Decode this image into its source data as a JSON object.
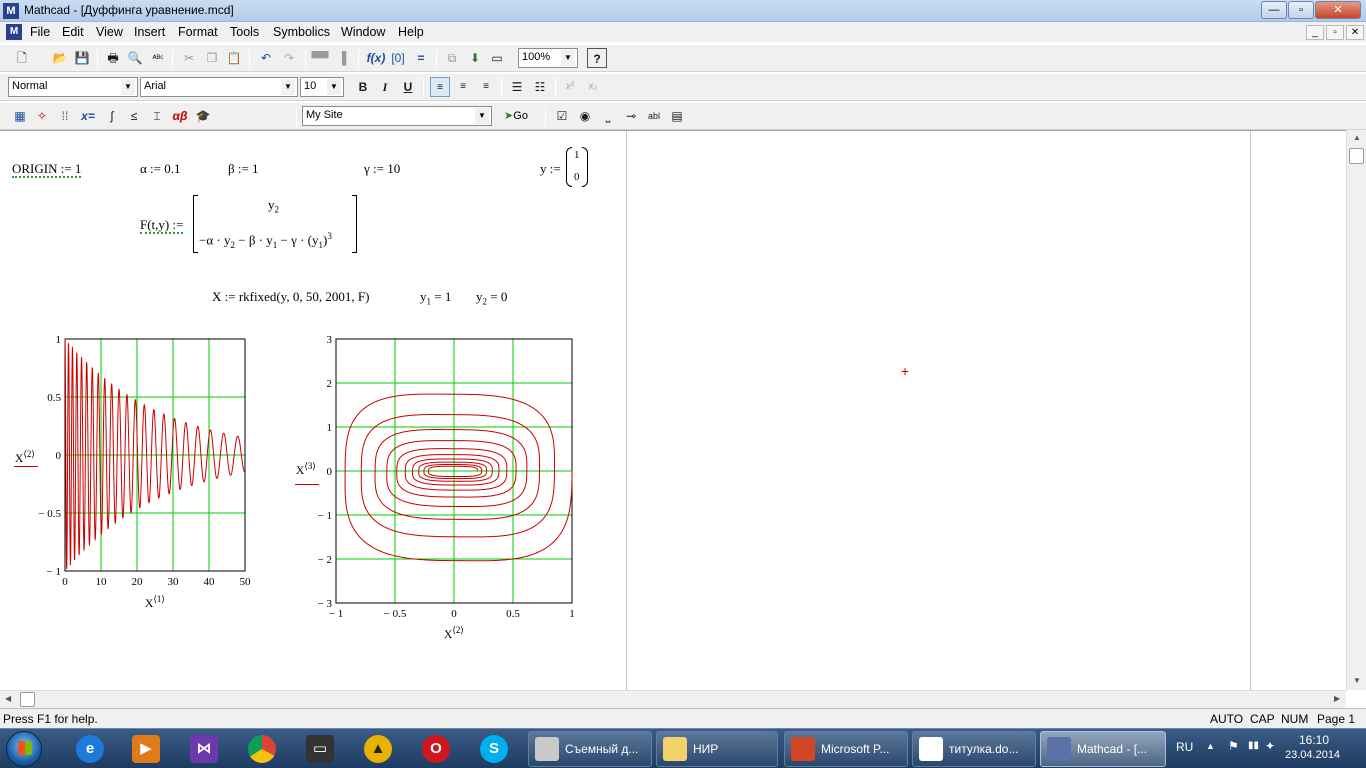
{
  "window": {
    "title": "Mathcad - [Дуффинга уравнение.mcd]",
    "logo": "M",
    "minimize": "—",
    "maximize": "▫",
    "close": "✕"
  },
  "menu": {
    "items": [
      "File",
      "Edit",
      "View",
      "Insert",
      "Format",
      "Tools",
      "Symbolics",
      "Window",
      "Help"
    ],
    "doc_controls": [
      "_",
      "▫",
      "✕"
    ]
  },
  "toolbar_standard": {
    "zoom": "100%",
    "icons": [
      "new-icon",
      "open-icon",
      "save-icon",
      "print-icon",
      "print-preview-icon",
      "spell-check-icon",
      "cut-icon",
      "copy-icon",
      "paste-icon",
      "undo-icon",
      "redo-icon",
      "align-across-icon",
      "align-down-icon",
      "insert-function-icon",
      "insert-unit-icon",
      "calculate-icon",
      "resources-icon",
      "component-icon",
      "hyperlink-icon",
      "help-icon"
    ]
  },
  "toolbar_formatting": {
    "style": "Normal",
    "font": "Arial",
    "size": "10",
    "bold": "B",
    "italic": "I",
    "underline": "U",
    "superscript": "x²",
    "subscript": "x₂"
  },
  "toolbar_math": {
    "site": "My Site",
    "go": "Go",
    "palette_labels": [
      "x=",
      "αβ"
    ]
  },
  "worksheet": {
    "origin": "ORIGIN := 1",
    "alpha": "α := 0.1",
    "beta": "β := 1",
    "gamma": "γ := 10",
    "y_def": "y :=",
    "y_vec": [
      "1",
      "0"
    ],
    "F_def": "F(t,y) :=",
    "F_row1": "y",
    "F_row1_sub": "2",
    "F_row2_a": "−α · y",
    "F_row2_a_sub": "2",
    "F_row2_b": " − β · y",
    "F_row2_b_sub": "1",
    "F_row2_c": " − γ · (y",
    "F_row2_c_sub": "1",
    "F_row2_d": ")",
    "F_row2_exp": "3",
    "solver": "X := rkfixed(y, 0, 50, 2001, F)",
    "y1": "y",
    "y1_sub": "1",
    "y1_val": " = 1",
    "y2": "y",
    "y2_sub": "2",
    "y2_val": " = 0"
  },
  "plot1": {
    "y_ticks": [
      "1",
      "0.5",
      "0",
      "− 0.5",
      "− 1"
    ],
    "x_ticks": [
      "0",
      "10",
      "20",
      "30",
      "40",
      "50"
    ],
    "ylabel": "X",
    "ylabel_sup": "⟨2⟩",
    "xlabel": "X",
    "xlabel_sup": "⟨1⟩"
  },
  "plot2": {
    "y_ticks": [
      "3",
      "2",
      "1",
      "0",
      "− 1",
      "− 2",
      "− 3"
    ],
    "x_ticks": [
      "− 1",
      "− 0.5",
      "0",
      "0.5",
      "1"
    ],
    "ylabel": "X",
    "ylabel_sup": "⟨3⟩",
    "xlabel": "X",
    "xlabel_sup": "⟨2⟩"
  },
  "chart_data": [
    {
      "type": "line",
      "description_series": "X<2> vs X<1>",
      "xlim": [
        0,
        50
      ],
      "ylim": [
        -1,
        1
      ],
      "grid": true,
      "line_color": "#cc0000",
      "grid_color": "#00cc00",
      "x_ticks": [
        0,
        10,
        20,
        30,
        40,
        50
      ],
      "y_ticks": [
        -1,
        -0.5,
        0,
        0.5,
        1
      ],
      "series": [
        {
          "start_amplitude": 1.0,
          "end_amplitude": 0.15,
          "initial_period": 0.9,
          "final_period": 4.1,
          "x_start": 0,
          "x_end": 50
        }
      ]
    },
    {
      "type": "line",
      "description_series": "X<3> vs X<2> (phase portrait)",
      "xlim": [
        -1,
        1
      ],
      "ylim": [
        -3,
        3
      ],
      "grid": true,
      "line_color": "#cc0000",
      "grid_color": "#00cc00",
      "x_ticks": [
        -1,
        -0.5,
        0,
        0.5,
        1
      ],
      "y_ticks": [
        -3,
        -2,
        -1,
        0,
        1,
        2,
        3
      ],
      "series": [
        {
          "shape": "inward spiral",
          "start_point": [
            1,
            0
          ],
          "outer_x_extent": 1.0,
          "outer_y_extent": 2.2,
          "inner_x_extent": 0.2,
          "inner_y_extent": 0.1,
          "loops": 10
        }
      ]
    }
  ],
  "status": {
    "help": "Press F1 for help.",
    "auto": "AUTO",
    "cap": "CAP",
    "num": "NUM",
    "page": "Page 1"
  },
  "taskbar": {
    "tasks": [
      "Съемный д...",
      "НИР",
      "Microsoft P...",
      "титулка.do...",
      "Mathcad - [..."
    ],
    "lang": "RU",
    "time": "16:10",
    "date": "23.04.2014"
  },
  "colors": {
    "plot_line": "#cc0000",
    "grid": "#00cc00",
    "taskbar": "#1e3b61"
  }
}
